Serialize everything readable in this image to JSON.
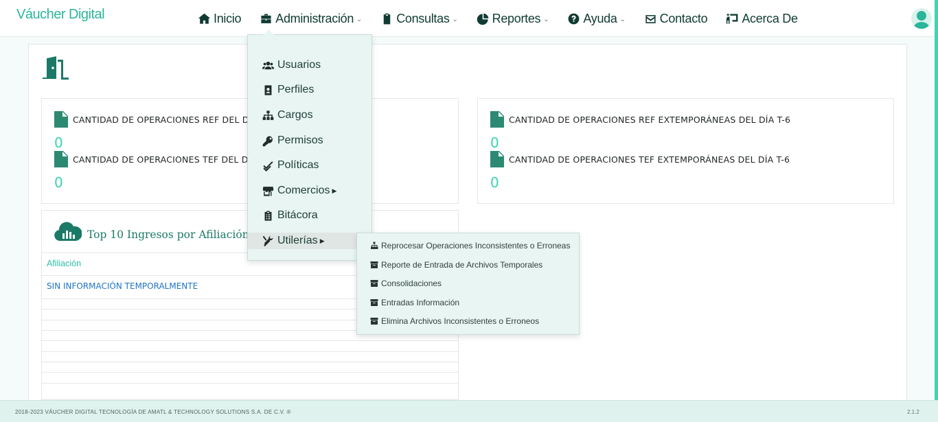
{
  "brand": {
    "name": "Váucher Digital"
  },
  "nav": {
    "inicio": "Inicio",
    "administracion": "Administración",
    "consultas": "Consultas",
    "reportes": "Reportes",
    "ayuda": "Ayuda",
    "contacto": "Contacto",
    "acerca": "Acerca De"
  },
  "admin_menu": {
    "items": [
      "Usuarios",
      "Perfiles",
      "Cargos",
      "Permisos",
      "Políticas",
      "Comercios",
      "Bitácora",
      "Utilerías"
    ]
  },
  "utilerias_menu": {
    "items": [
      "Reprocesar Operaciones Inconsistentes o Erroneas",
      "Reporte de Entrada de Archivos Temporales",
      "Consolidaciones",
      "Entradas Información",
      "Elimina Archivos Inconsistentes o Erroneos"
    ]
  },
  "stats_left": {
    "ref_label": "CANTIDAD DE OPERACIONES REF DEL DÍ",
    "ref_value": "0",
    "tef_label": "CANTIDAD DE OPERACIONES TEF DEL DÍ",
    "tef_value": "0"
  },
  "stats_right": {
    "ref_label": "CANTIDAD DE OPERACIONES REF EXTEMPORÁNEAS DEL DÍA T-6",
    "ref_value": "0",
    "tef_label": "CANTIDAD DE OPERACIONES TEF EXTEMPORÁNEAS DEL DÍA T-6",
    "tef_value": "0"
  },
  "top10": {
    "title": "Top 10 Ingresos por Afiliación d",
    "column": "Afiliación",
    "empty_message": "SIN INFORMACIÓN TEMPORALMENTE"
  },
  "footer": {
    "copyright": "2018-2023 VÁUCHER DIGITAL TECNOLOGÍA DE AMATL & TECHNOLOGY SOLUTIONS S.A. DE C.V. ®",
    "version": "2.1.2"
  },
  "colors": {
    "brand": "#2bb59a",
    "accent": "#39d3b2",
    "dark_green": "#2c8a73",
    "menu_bg": "#e8f5f2"
  }
}
